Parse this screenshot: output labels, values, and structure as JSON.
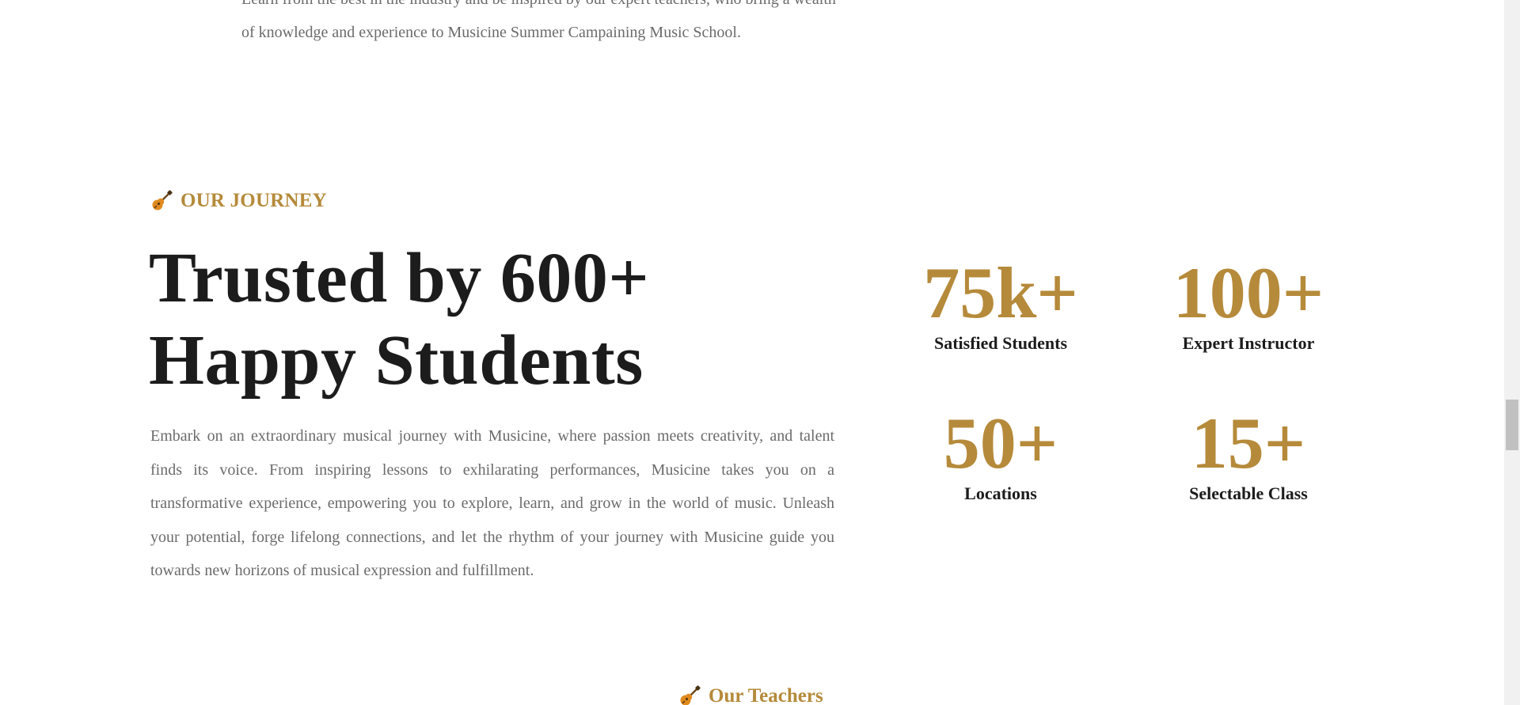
{
  "intro": {
    "text": "Learn from the best in the industry and be inspired by our expert teachers, who bring a wealth of knowledge and experience to Musicine Summer Campaining Music School."
  },
  "journey": {
    "icon": "guitar-icon",
    "eyebrow": "OUR JOURNEY",
    "headline_line1": "Trusted by 600+",
    "headline_line2": "Happy Students",
    "body": "Embark on an extraordinary musical journey with Musicine, where passion meets creativity, and talent finds its voice. From inspiring lessons to exhilarating performances, Musicine takes you on a transformative experience, empowering you to explore, learn, and grow in the world of music. Unleash your potential, forge lifelong connections, and let the rhythm of your journey with Musicine guide you towards new horizons of musical expression and fulfillment."
  },
  "stats": [
    {
      "value": "75k+",
      "label": "Satisfied Students"
    },
    {
      "value": "100+",
      "label": "Expert Instructor"
    },
    {
      "value": "50+",
      "label": "Locations"
    },
    {
      "value": "15+",
      "label": "Selectable Class"
    }
  ],
  "teachers": {
    "icon": "guitar-icon",
    "eyebrow": "Our Teachers"
  },
  "colors": {
    "accent": "#b58a3a",
    "heading": "#1c1c1c",
    "body_text": "#6b6b6b"
  }
}
